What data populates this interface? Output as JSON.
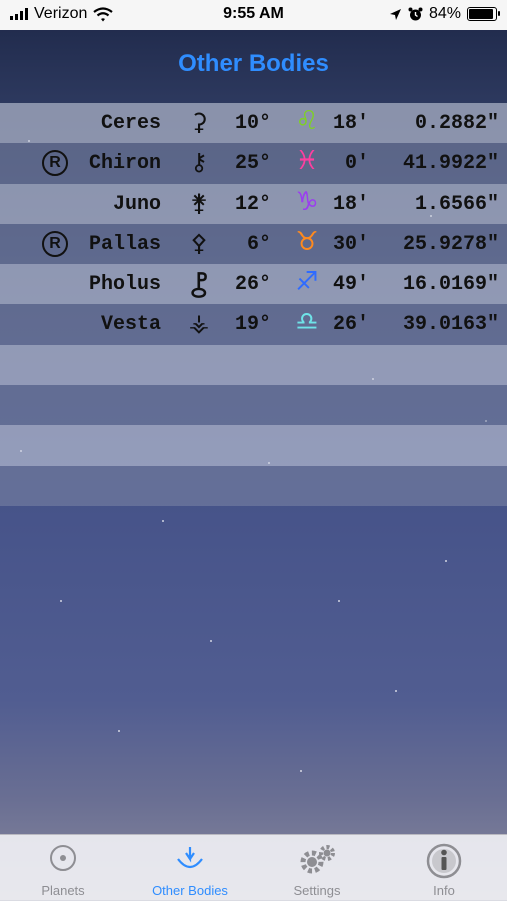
{
  "status": {
    "carrier": "Verizon",
    "time": "9:55 AM",
    "battery": "84%",
    "battery_level": 0.84
  },
  "nav": {
    "title": "Other Bodies"
  },
  "bodies": [
    {
      "retro": "",
      "name": "Ceres",
      "symbol": "⚳",
      "deg": "10°",
      "sign": "♌",
      "sign_color": "#7ed321",
      "min": "18'",
      "sec": "0.2882\""
    },
    {
      "retro": "R",
      "name": "Chiron",
      "symbol": "⚷",
      "deg": "25°",
      "sign": "♓",
      "sign_color": "#ff3fa0",
      "min": "0'",
      "sec": "41.9922\""
    },
    {
      "retro": "",
      "name": "Juno",
      "symbol": "⚵",
      "deg": "12°",
      "sign": "♑",
      "sign_color": "#9b3df0",
      "min": "18'",
      "sec": "1.6566\""
    },
    {
      "retro": "R",
      "name": "Pallas",
      "symbol": "⚴",
      "deg": "6°",
      "sign": "♉",
      "sign_color": "#ff8a1e",
      "min": "30'",
      "sec": "25.9278\""
    },
    {
      "retro": "",
      "name": "Pholus",
      "symbol": "⯛",
      "deg": "26°",
      "sign": "♐",
      "sign_color": "#2f6bff",
      "min": "49'",
      "sec": "16.0169\""
    },
    {
      "retro": "",
      "name": "Vesta",
      "symbol": "⚶",
      "deg": "19°",
      "sign": "♎",
      "sign_color": "#6fe3e8",
      "min": "26'",
      "sec": "39.0163\""
    }
  ],
  "empty_rows": 4,
  "tabs": [
    {
      "label": "Planets",
      "icon": "target-icon",
      "active": false
    },
    {
      "label": "Other Bodies",
      "icon": "vesta-icon",
      "active": true
    },
    {
      "label": "Settings",
      "icon": "gear-icon",
      "active": false
    },
    {
      "label": "Info",
      "icon": "info-icon",
      "active": false
    }
  ],
  "colors": {
    "accent": "#2f8dff",
    "tab_inactive": "#8e8e93"
  }
}
